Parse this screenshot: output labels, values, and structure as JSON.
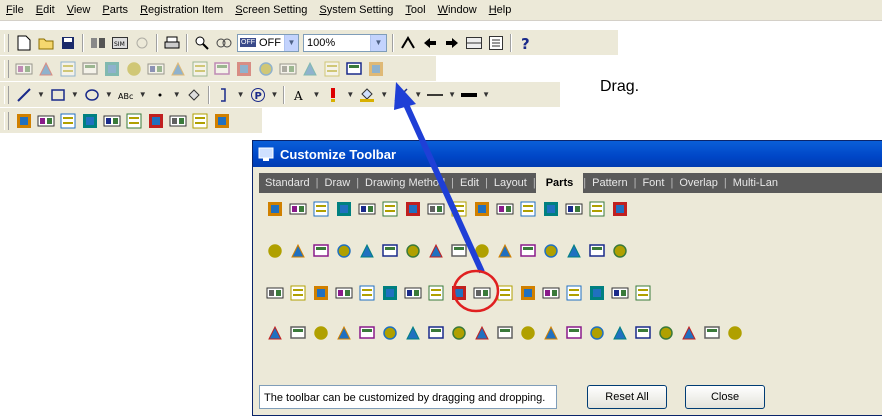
{
  "menu": [
    "File",
    "Edit",
    "View",
    "Parts",
    "Registration Item",
    "Screen Setting",
    "System Setting",
    "Tool",
    "Window",
    "Help"
  ],
  "toolbar": {
    "display_mode": "OFF",
    "zoom": "100%"
  },
  "instruction": "Drag.",
  "colors": {
    "arrow": "#1f3fd6",
    "highlight_circle": "#e02020",
    "title_bar": "#0a5fd8"
  },
  "dialog": {
    "title": "Customize Toolbar",
    "tabs": [
      "Standard",
      "Draw",
      "Drawing Method",
      "Edit",
      "Layout",
      "Parts",
      "Pattern",
      "Font",
      "Overlap",
      "Multi-Lan"
    ],
    "active_tab": "Parts",
    "status": "The toolbar can be customized by dragging and dropping.",
    "reset_label": "Reset All",
    "close_label": "Close"
  }
}
